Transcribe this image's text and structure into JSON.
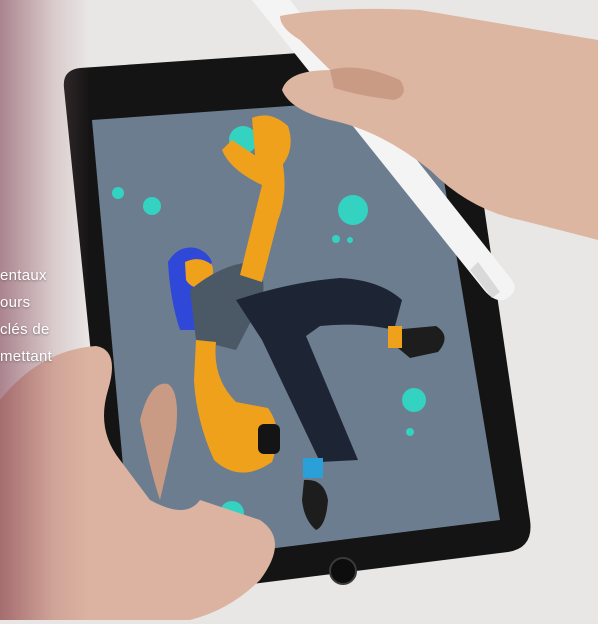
{
  "background_text": {
    "lines": [
      "entaux",
      "ours",
      "clés de",
      "mettant"
    ]
  },
  "colors": {
    "table": "#e8e6e4",
    "tablet_bezel": "#121212",
    "screen": "#6c7d8f",
    "skin": "#f0a11c",
    "hair": "#3048d8",
    "shirt": "#4a5965",
    "pants": "#1d2433",
    "accent_teal": "#34d2c0",
    "pencil": "#f4f4f4"
  },
  "icons": [
    "home-button-icon"
  ]
}
